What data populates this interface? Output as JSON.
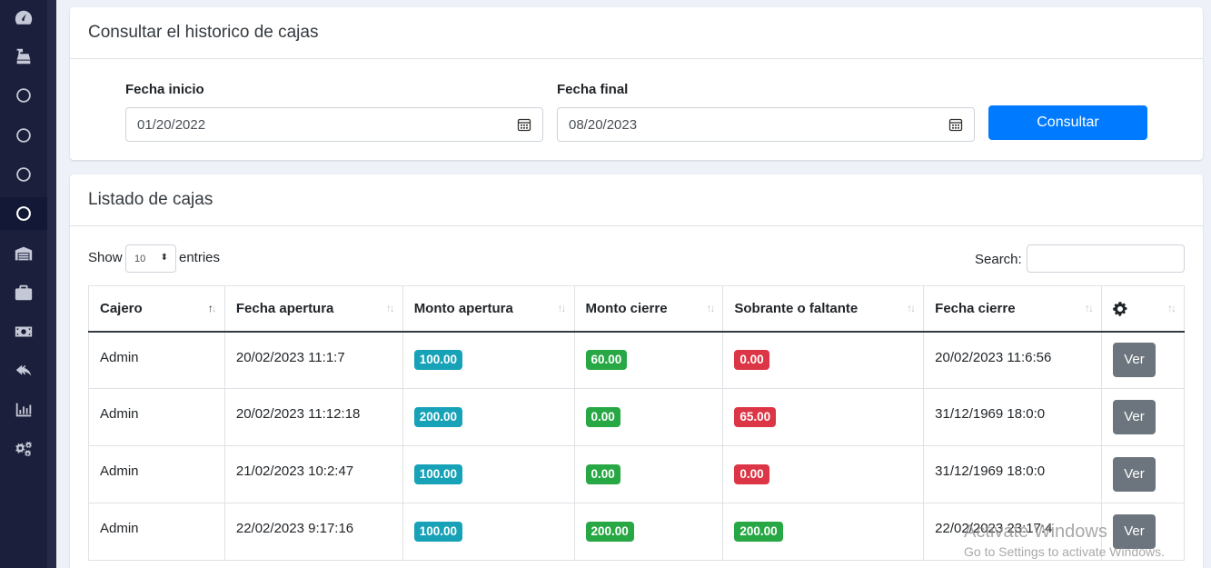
{
  "sidebar": {
    "items": [
      {
        "icon": "tachometer-icon"
      },
      {
        "icon": "cash-register-icon"
      },
      {
        "icon": "circle-icon"
      },
      {
        "icon": "circle-icon"
      },
      {
        "icon": "circle-icon"
      },
      {
        "icon": "circle-icon",
        "active": true
      },
      {
        "icon": "warehouse-icon"
      },
      {
        "icon": "briefcase-icon"
      },
      {
        "icon": "money-bill-icon"
      },
      {
        "icon": "reply-icon"
      },
      {
        "icon": "chart-bar-icon"
      },
      {
        "icon": "cogs-icon"
      }
    ]
  },
  "filter": {
    "title": "Consultar el historico de cajas",
    "start_label": "Fecha inicio",
    "start_value": "01/20/2022",
    "end_label": "Fecha final",
    "end_value": "08/20/2023",
    "submit_label": "Consultar"
  },
  "list": {
    "title": "Listado de cajas",
    "show_label": "Show",
    "entries_value": "10",
    "entries_label": "entries",
    "search_label": "Search:",
    "columns": [
      "Cajero",
      "Fecha apertura",
      "Monto apertura",
      "Monto cierre",
      "Sobrante o faltante",
      "Fecha cierre"
    ],
    "action_label": "Ver",
    "rows": [
      {
        "cajero": "Admin",
        "fecha_apertura": "20/02/2023 11:1:7",
        "monto_apertura": "100.00",
        "monto_cierre": "60.00",
        "sobrante": "0.00",
        "sobrante_status": "danger",
        "fecha_cierre": "20/02/2023 11:6:56"
      },
      {
        "cajero": "Admin",
        "fecha_apertura": "20/02/2023 11:12:18",
        "monto_apertura": "200.00",
        "monto_cierre": "0.00",
        "sobrante": "65.00",
        "sobrante_status": "danger",
        "fecha_cierre": "31/12/1969 18:0:0"
      },
      {
        "cajero": "Admin",
        "fecha_apertura": "21/02/2023 10:2:47",
        "monto_apertura": "100.00",
        "monto_cierre": "0.00",
        "sobrante": "0.00",
        "sobrante_status": "danger",
        "fecha_cierre": "31/12/1969 18:0:0"
      },
      {
        "cajero": "Admin",
        "fecha_apertura": "22/02/2023 9:17:16",
        "monto_apertura": "100.00",
        "monto_cierre": "200.00",
        "sobrante": "200.00",
        "sobrante_status": "success",
        "fecha_cierre": "22/02/2023 23:17:4"
      }
    ]
  },
  "watermark": {
    "line1": "Activate Windows",
    "line2": "Go to Settings to activate Windows."
  },
  "colors": {
    "primary": "#007bff",
    "info": "#17a2b8",
    "success": "#28a745",
    "danger": "#dc3545",
    "secondary": "#6c757d",
    "sidebar": "#1b1f3b"
  }
}
